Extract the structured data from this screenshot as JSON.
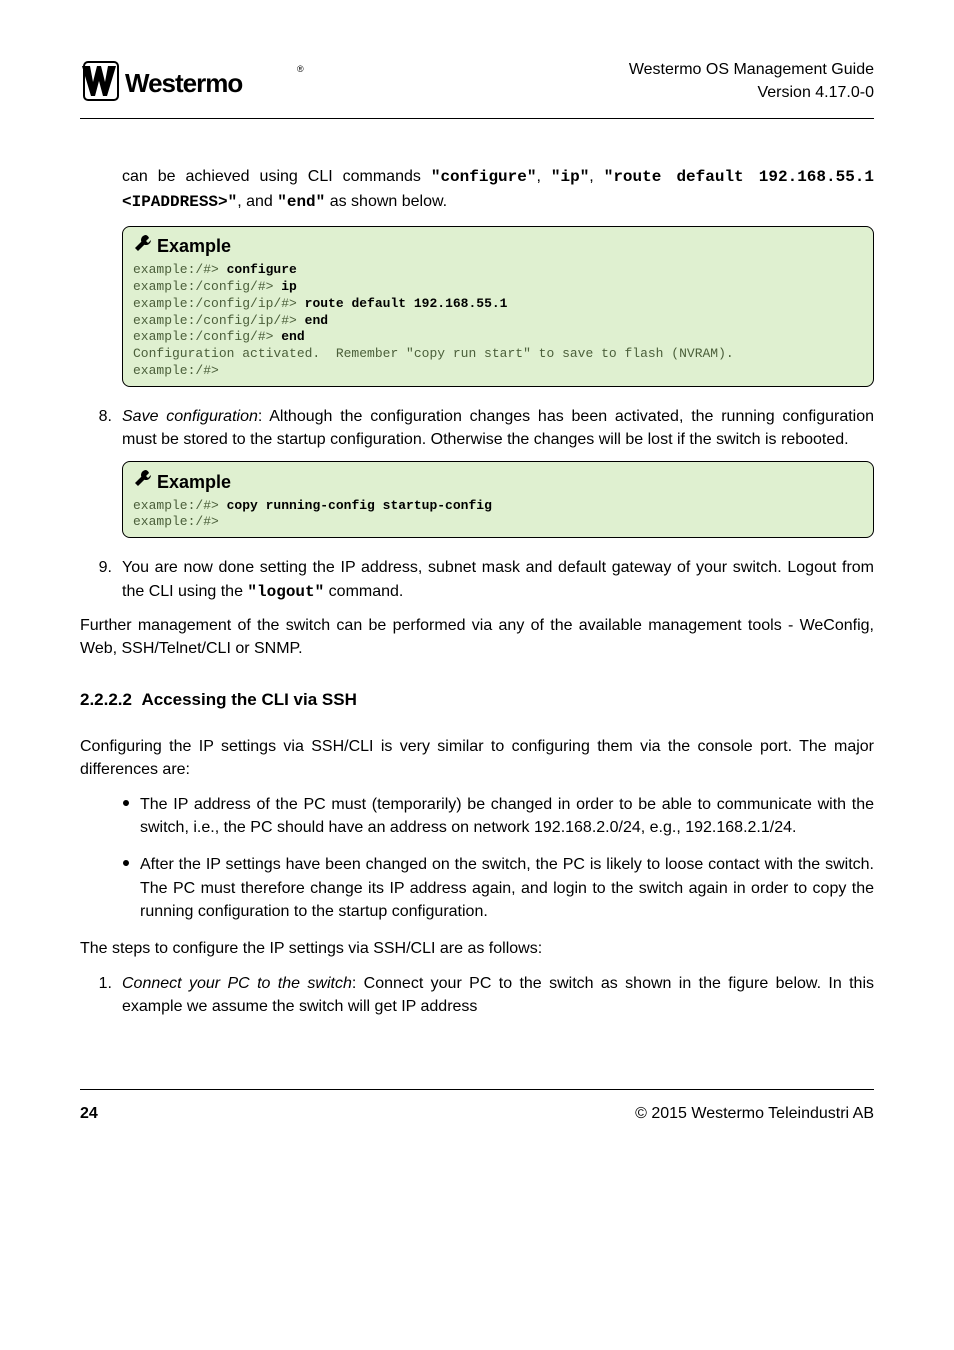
{
  "header": {
    "logo_text": "Westermo",
    "guide_title": "Westermo OS Management Guide",
    "version": "Version 4.17.0-0"
  },
  "intro": {
    "text_before_cmds": "can be achieved using CLI commands ",
    "cmd1": "\"configure\"",
    "sep1": ", ",
    "cmd2": "\"ip\"",
    "sep2": ", ",
    "cmd3": "\"route default 192.168.55.1 <IPADDRESS>\"",
    "sep3": ", and ",
    "cmd4": "\"end\"",
    "text_after_cmds": " as shown below."
  },
  "example1": {
    "title": "Example",
    "lines": [
      {
        "prompt": "example:/#> ",
        "cmd": "configure"
      },
      {
        "prompt": "example:/config/#> ",
        "cmd": "ip"
      },
      {
        "prompt": "example:/config/ip/#> ",
        "cmd": "route default 192.168.55.1"
      },
      {
        "prompt": "example:/config/ip/#> ",
        "cmd": "end"
      },
      {
        "prompt": "example:/config/#> ",
        "cmd": "end"
      },
      {
        "prompt": "Configuration activated.  Remember \"copy run start\" to save to flash (NVRAM).",
        "cmd": ""
      },
      {
        "prompt": "example:/#>",
        "cmd": ""
      }
    ]
  },
  "step8": {
    "num": "8.",
    "title": "Save configuration",
    "text": ": Although the configuration changes has been activated, the running configuration must be stored to the startup configuration. Otherwise the changes will be lost if the switch is rebooted."
  },
  "example2": {
    "title": "Example",
    "lines": [
      {
        "prompt": "example:/#> ",
        "cmd": "copy running-config startup-config"
      },
      {
        "prompt": "example:/#>",
        "cmd": ""
      }
    ]
  },
  "step9": {
    "num": "9.",
    "text_before": "You are now done setting the IP address, subnet mask and default gateway of your switch. Logout from the CLI using the ",
    "cmd": "\"logout\"",
    "text_after": " command."
  },
  "further": "Further management of the switch can be performed via any of the available management tools - WeConfig, Web, SSH/Telnet/CLI or SNMP.",
  "section": {
    "num": "2.2.2.2",
    "title": "Accessing the CLI via SSH"
  },
  "section_intro": "Configuring the IP settings via SSH/CLI is very similar to configuring them via the console port. The major differences are:",
  "bullets": [
    "The IP address of the PC must (temporarily) be changed in order to be able to communicate with the switch, i.e., the PC should have an address on network 192.168.2.0/24, e.g., 192.168.2.1/24.",
    "After the IP settings have been changed on the switch, the PC is likely to loose contact with the switch. The PC must therefore change its IP address again, and login to the switch again in order to copy the running configuration to the startup configuration."
  ],
  "steps_intro": "The steps to configure the IP settings via SSH/CLI are as follows:",
  "step1": {
    "num": "1.",
    "title": "Connect your PC to the switch",
    "text": ": Connect your PC to the switch as shown in the figure below. In this example we assume the switch will get IP address"
  },
  "footer": {
    "page": "24",
    "copyright": "© 2015 Westermo Teleindustri AB"
  }
}
